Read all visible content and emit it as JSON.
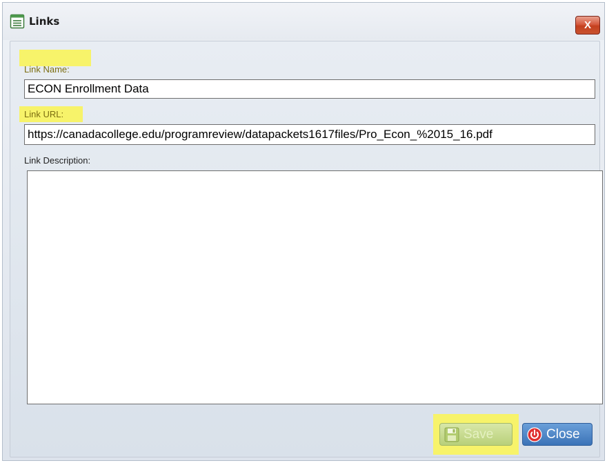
{
  "window": {
    "title": "Links",
    "close_glyph": "X"
  },
  "form": {
    "link_name_label": "Link Name:",
    "link_name_value": "ECON Enrollment Data",
    "link_url_label": "Link URL:",
    "link_url_value": "https://canadacollege.edu/programreview/datapackets1617files/Pro_Econ_%2015_16.pdf",
    "link_description_label": "Link Description:",
    "link_description_value": ""
  },
  "buttons": {
    "save_label": "Save",
    "close_label": "Close"
  },
  "icons": {
    "title": "form-window-icon",
    "save": "floppy-disk-icon",
    "close": "power-icon",
    "dialog_close": "close-x-icon"
  },
  "colors": {
    "highlight": "#f7f36a",
    "close_x_bg": "#d65a3e",
    "close_button_bg": "#3b73b7",
    "save_button_bg": "#c4d98c"
  }
}
